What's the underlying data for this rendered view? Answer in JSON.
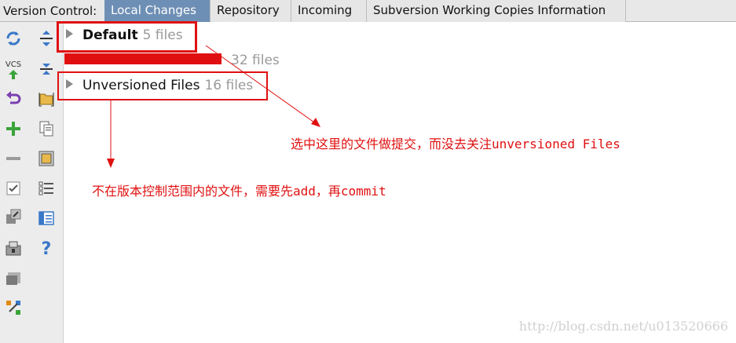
{
  "header": {
    "label": "Version Control:",
    "tabs": [
      {
        "label": "Local Changes",
        "active": true
      },
      {
        "label": "Repository",
        "active": false
      },
      {
        "label": "Incoming",
        "active": false
      },
      {
        "label": "Subversion Working Copies Information",
        "active": false
      }
    ]
  },
  "toolbar": {
    "vcs_label": "VCS"
  },
  "tree": {
    "default": {
      "name": "Default",
      "count": "5 files"
    },
    "obscured": {
      "name": "",
      "count": "32 files"
    },
    "unversioned": {
      "name": "Unversioned Files",
      "count": "16 files"
    }
  },
  "annotations": {
    "note1": "选中这里的文件做提交，而没去关注unversioned Files",
    "note2": "不在版本控制范围内的文件，需要先add，再commit"
  },
  "watermark": "http://blog.csdn.net/u013520666",
  "colors": {
    "active_tab": "#6e8fb5",
    "annotation_red": "#e01010",
    "sidebar_bg": "#ececec"
  }
}
